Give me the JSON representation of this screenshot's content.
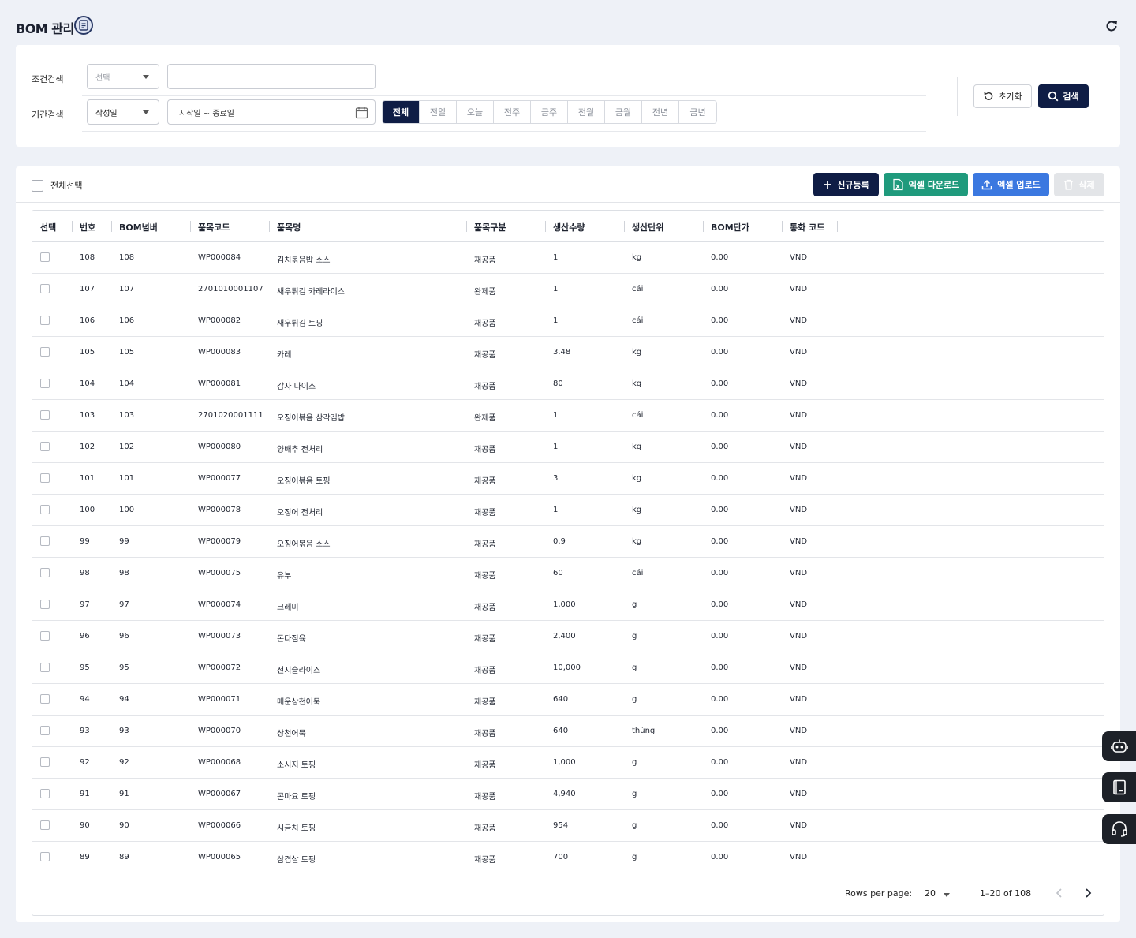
{
  "header": {
    "title": "BOM 관리"
  },
  "search": {
    "condition_label": "조건검색",
    "condition_placeholder": "선택",
    "keyword_value": "",
    "period_label": "기간검색",
    "period_type": "작성일",
    "date_range_placeholder": "시작일 ~ 종료일",
    "periods": [
      "전체",
      "전일",
      "오늘",
      "전주",
      "금주",
      "전월",
      "금월",
      "전년",
      "금년"
    ],
    "active_period": "전체",
    "reset_label": "초기화",
    "search_label": "검색"
  },
  "toolbar": {
    "select_all_label": "전체선택",
    "new_label": "신규등록",
    "excel_download_label": "엑셀 다운로드",
    "excel_upload_label": "엑셀 업로드",
    "delete_label": "삭제"
  },
  "table": {
    "columns": [
      "선택",
      "번호",
      "BOM넘버",
      "품목코드",
      "품목명",
      "품목구분",
      "생산수량",
      "생산단위",
      "BOM단가",
      "통화 코드"
    ],
    "rows": [
      [
        "108",
        "108",
        "WP000084",
        "김치볶음밥 소스",
        "재공품",
        "1",
        "kg",
        "0.00",
        "VND"
      ],
      [
        "107",
        "107",
        "2701010001107",
        "새우튀김 카레라이스",
        "완제품",
        "1",
        "cái",
        "0.00",
        "VND"
      ],
      [
        "106",
        "106",
        "WP000082",
        "새우튀김 토핑",
        "재공품",
        "1",
        "cái",
        "0.00",
        "VND"
      ],
      [
        "105",
        "105",
        "WP000083",
        "카레",
        "재공품",
        "3.48",
        "kg",
        "0.00",
        "VND"
      ],
      [
        "104",
        "104",
        "WP000081",
        "감자 다이스",
        "재공품",
        "80",
        "kg",
        "0.00",
        "VND"
      ],
      [
        "103",
        "103",
        "2701020001111",
        "오징어볶음 삼각김밥",
        "완제품",
        "1",
        "cái",
        "0.00",
        "VND"
      ],
      [
        "102",
        "102",
        "WP000080",
        "양배추 전처리",
        "재공품",
        "1",
        "kg",
        "0.00",
        "VND"
      ],
      [
        "101",
        "101",
        "WP000077",
        "오징어볶음 토핑",
        "재공품",
        "3",
        "kg",
        "0.00",
        "VND"
      ],
      [
        "100",
        "100",
        "WP000078",
        "오징어 전처리",
        "재공품",
        "1",
        "kg",
        "0.00",
        "VND"
      ],
      [
        "99",
        "99",
        "WP000079",
        "오징어볶음 소스",
        "재공품",
        "0.9",
        "kg",
        "0.00",
        "VND"
      ],
      [
        "98",
        "98",
        "WP000075",
        "유부",
        "재공품",
        "60",
        "cái",
        "0.00",
        "VND"
      ],
      [
        "97",
        "97",
        "WP000074",
        "크레미",
        "재공품",
        "1,000",
        "g",
        "0.00",
        "VND"
      ],
      [
        "96",
        "96",
        "WP000073",
        "돈다짐육",
        "재공품",
        "2,400",
        "g",
        "0.00",
        "VND"
      ],
      [
        "95",
        "95",
        "WP000072",
        "전지슬라이스",
        "재공품",
        "10,000",
        "g",
        "0.00",
        "VND"
      ],
      [
        "94",
        "94",
        "WP000071",
        "매운상천어묵",
        "재공품",
        "640",
        "g",
        "0.00",
        "VND"
      ],
      [
        "93",
        "93",
        "WP000070",
        "상천어묵",
        "재공품",
        "640",
        "thùng",
        "0.00",
        "VND"
      ],
      [
        "92",
        "92",
        "WP000068",
        "소시지 토핑",
        "재공품",
        "1,000",
        "g",
        "0.00",
        "VND"
      ],
      [
        "91",
        "91",
        "WP000067",
        "콘마요 토핑",
        "재공품",
        "4,940",
        "g",
        "0.00",
        "VND"
      ],
      [
        "90",
        "90",
        "WP000066",
        "시금치 토핑",
        "재공품",
        "954",
        "g",
        "0.00",
        "VND"
      ],
      [
        "89",
        "89",
        "WP000065",
        "삼겹살 토핑",
        "재공품",
        "700",
        "g",
        "0.00",
        "VND"
      ]
    ]
  },
  "pagination": {
    "rows_per_page_label": "Rows per page:",
    "rows_per_page": "20",
    "range": "1–20 of 108"
  },
  "colors": {
    "primary": "#0f1d45",
    "excel_green": "#1f9a7c",
    "upload_blue": "#3b78e0",
    "background": "#eef1f7"
  },
  "icons": [
    "document-icon",
    "refresh-icon",
    "calendar-icon",
    "reset-icon",
    "search-icon",
    "plus-icon",
    "excel-icon",
    "upload-icon",
    "trash-icon",
    "chevron-left-icon",
    "chevron-right-icon",
    "robot-icon",
    "manual-icon",
    "headset-icon"
  ]
}
